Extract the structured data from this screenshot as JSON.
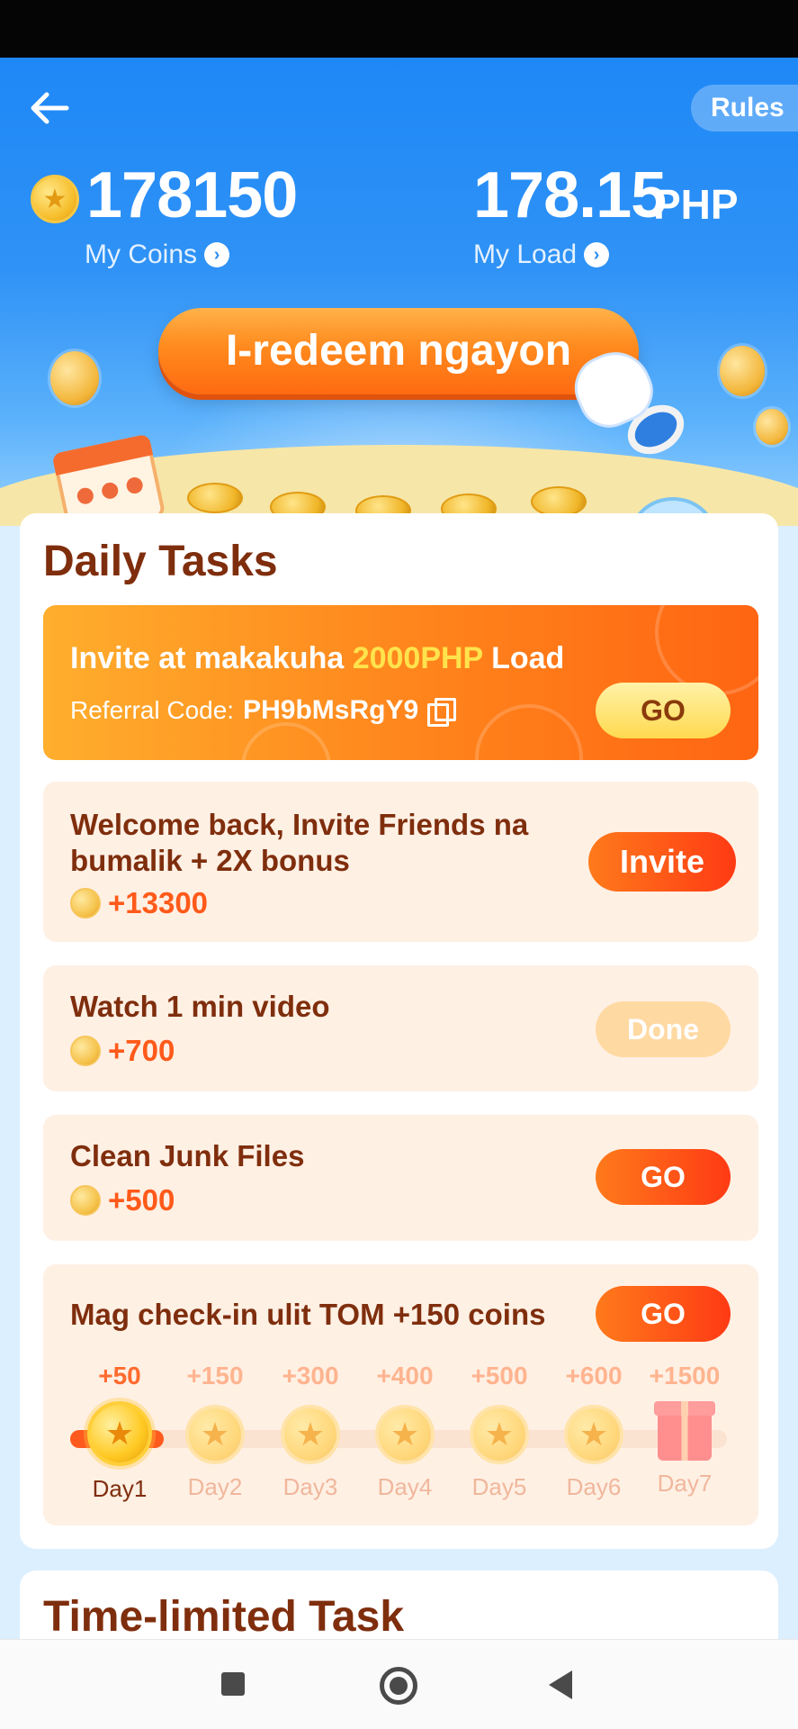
{
  "header": {
    "rules_label": "Rules",
    "coins_value": "178150",
    "coins_label": "My Coins",
    "load_value": "178.15",
    "load_unit": "PHP",
    "load_label": "My Load",
    "redeem_label": "I-redeem ngayon"
  },
  "daily_tasks": {
    "title": "Daily Tasks",
    "invite_banner": {
      "title_prefix": "Invite at makakuha ",
      "title_highlight": "2000PHP",
      "title_suffix": " Load",
      "referral_label": "Referral Code:",
      "referral_code": "PH9bMsRgY9",
      "button": "GO"
    },
    "tasks": [
      {
        "title_line1": "Welcome back, Invite Friends na",
        "title_line2": "bumalik + 2X bonus",
        "reward": "+13300",
        "button": "Invite"
      },
      {
        "title": "Watch 1 min video",
        "reward": "+700",
        "button": "Done"
      },
      {
        "title": "Clean Junk Files",
        "reward": "+500",
        "button": "GO"
      }
    ],
    "checkin": {
      "title": "Mag check-in ulit TOM +150 coins",
      "button": "GO",
      "progress_days_done": 1,
      "days": [
        {
          "reward": "+50",
          "label": "Day1"
        },
        {
          "reward": "+150",
          "label": "Day2"
        },
        {
          "reward": "+300",
          "label": "Day3"
        },
        {
          "reward": "+400",
          "label": "Day4"
        },
        {
          "reward": "+500",
          "label": "Day5"
        },
        {
          "reward": "+600",
          "label": "Day6"
        },
        {
          "reward": "+1500",
          "label": "Day7"
        }
      ]
    }
  },
  "time_limited": {
    "title": "Time-limited Task"
  },
  "colors": {
    "brand_blue": "#1e88f6",
    "accent_orange": "#ff6512",
    "title_brown": "#7f2e0d"
  },
  "icons": [
    "back-arrow-icon",
    "coin-icon",
    "chevron-right-icon",
    "copy-icon",
    "star-coin-icon",
    "gift-icon"
  ]
}
